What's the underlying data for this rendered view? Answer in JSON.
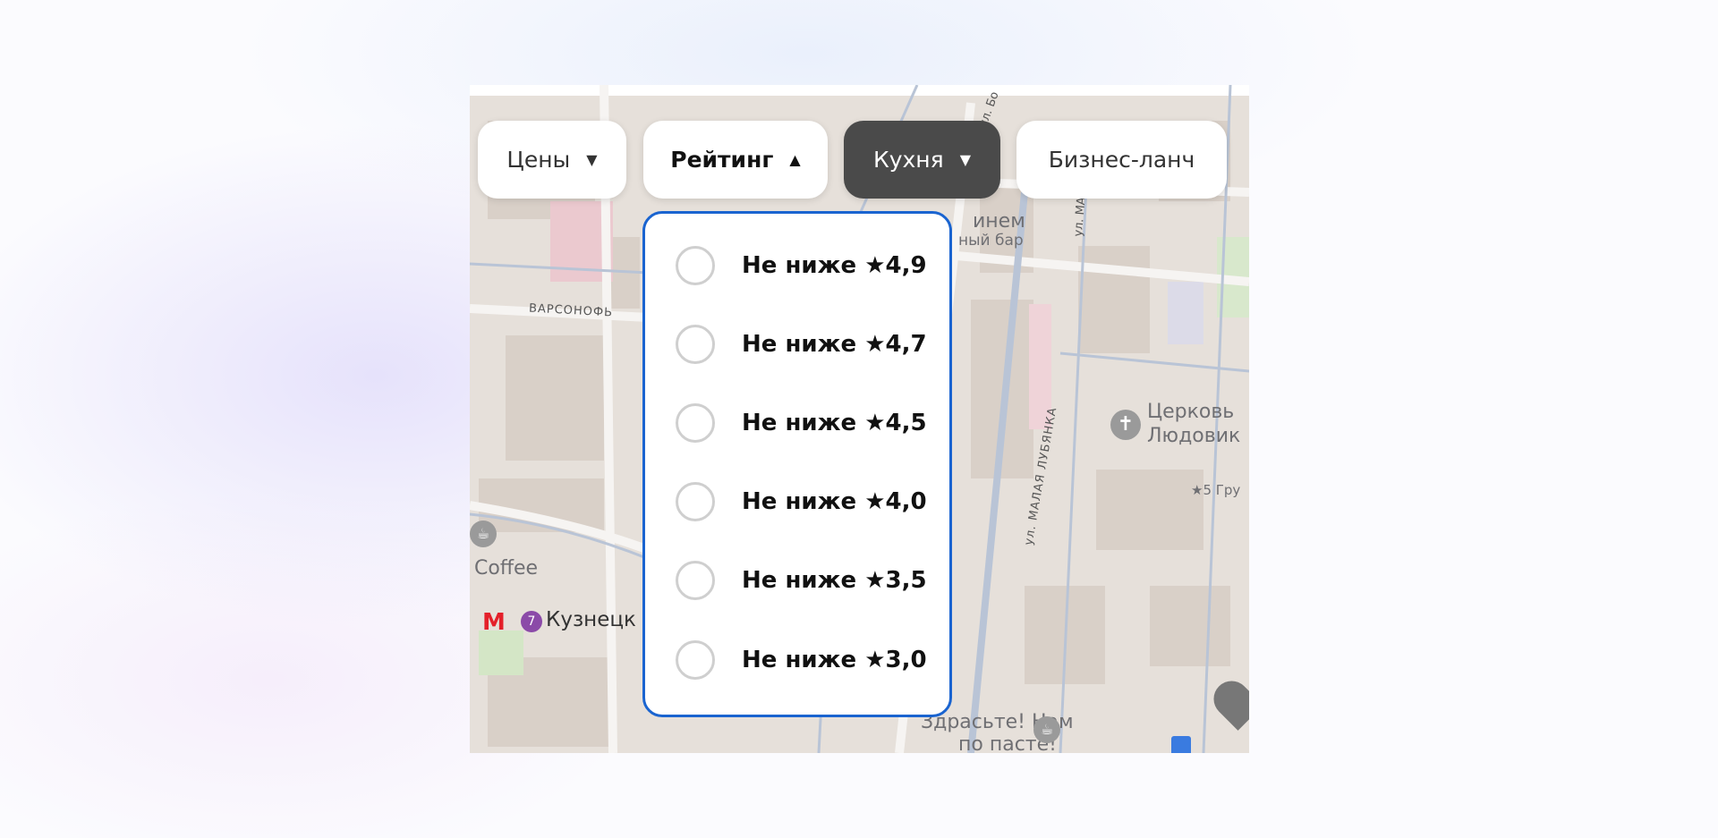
{
  "filters": [
    {
      "label": "Цены",
      "caret": "▼",
      "state": "default"
    },
    {
      "label": "Рейтинг",
      "caret": "▲",
      "state": "open"
    },
    {
      "label": "Кухня",
      "caret": "▼",
      "state": "active"
    },
    {
      "label": "Бизнес-ланч",
      "caret": "",
      "state": "default"
    }
  ],
  "rating_dropdown": {
    "options": [
      {
        "prefix": "Не ниже ",
        "star": "★",
        "value": "4,9",
        "selected": false
      },
      {
        "prefix": "Не ниже ",
        "star": "★",
        "value": "4,7",
        "selected": false
      },
      {
        "prefix": "Не ниже ",
        "star": "★",
        "value": "4,5",
        "selected": false
      },
      {
        "prefix": "Не ниже ",
        "star": "★",
        "value": "4,0",
        "selected": false
      },
      {
        "prefix": "Не ниже ",
        "star": "★",
        "value": "3,5",
        "selected": false
      },
      {
        "prefix": "Не ниже ",
        "star": "★",
        "value": "3,0",
        "selected": false
      }
    ]
  },
  "map_labels": {
    "poi1_line1": "инем",
    "poi1_line2": "ный бар",
    "street_varsonof": "ВАРСОНОФЬ",
    "street_lubyanka": "ул. МАЛАЯ ЛУБЯНКА",
    "street_bo": "ул. Бо",
    "street_ma": "ул. МА",
    "church_line1": "Церковь",
    "church_line2": "Людовик",
    "rating_poi": "★5 Гру",
    "coffee": "Coffee",
    "metro_line": "7",
    "metro_station": "Кузнецк",
    "cafe_line1": "Здрасьте! Нам",
    "cafe_line2": "по пасте!"
  },
  "colors": {
    "accent": "#1a64d0",
    "active_filter": "#4a4a4a",
    "metro": "#e4202a",
    "metro_line7": "#8b4aa8"
  }
}
